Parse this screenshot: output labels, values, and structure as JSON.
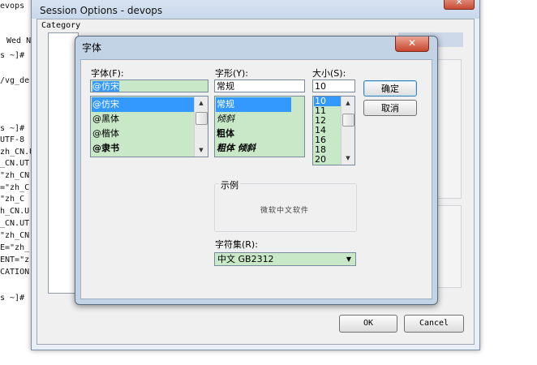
{
  "terminal": {
    "lines": [
      "Wed N",
      "s ~]#",
      "/vg_de",
      "s ~]#",
      "UTF-8",
      "zh_CN.U",
      "_CN.UT",
      "\"zh_CN",
      "=\"zh_C",
      "\"zh_C",
      "h_CN.U",
      "_CN.UT",
      "\"zh_CN",
      "E=\"zh_",
      "ENT=\"z",
      "CATION",
      "s ~]#"
    ],
    "tab_fragment": "evops ("
  },
  "session_window": {
    "title": "Session Options - devops",
    "close_glyph": "✕",
    "category_label": "Category",
    "ok_label": "OK",
    "cancel_label": "Cancel"
  },
  "font_dialog": {
    "title": "字体",
    "close_glyph": "✕",
    "font_label": "字体(F):",
    "font_value": "@仿宋",
    "font_list": [
      "@仿宋",
      "@黑体",
      "@楷体",
      "@隶书"
    ],
    "style_label": "字形(Y):",
    "style_value": "常规",
    "style_list": [
      "常规",
      "倾斜",
      "粗体",
      "粗体 倾斜"
    ],
    "size_label": "大小(S):",
    "size_value": "10",
    "size_list": [
      "10",
      "11",
      "12",
      "14",
      "16",
      "18",
      "20"
    ],
    "ok_label": "确定",
    "cancel_label": "取消",
    "sample_label": "示例",
    "sample_text": "微软中文软件",
    "charset_label": "字符集(R):",
    "charset_value": "中文 GB2312"
  }
}
